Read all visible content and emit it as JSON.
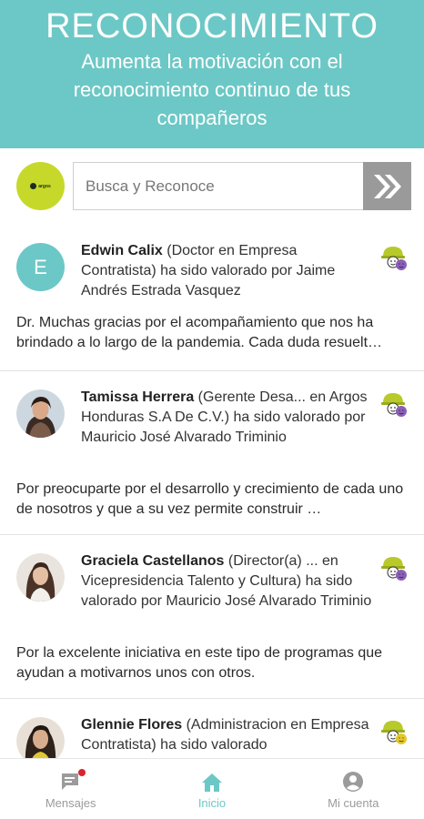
{
  "header": {
    "title": "RECONOCIMIENTO",
    "subtitle": "Aumenta la motivación con el reconocimiento continuo de tus compañeros"
  },
  "search": {
    "logo_text": "argos",
    "placeholder": "Busca y Reconoce"
  },
  "feed": [
    {
      "avatar_letter": "E",
      "name": "Edwin Calix",
      "detail": " (Doctor en Empresa Contratista) ha sido valorado por Jaime Andrés Estrada Vasquez",
      "message": "Dr. Muchas gracias por el acompañamiento  que  nos ha brindado a lo largo de la pandemia. Cada duda resuelt…"
    },
    {
      "name": "Tamissa Herrera",
      "detail": " (Gerente Desa... en Argos Honduras S.A De C.V.) ha sido valorado por Mauricio José Alvarado Triminio",
      "message": "Por preocuparte por el desarrollo y crecimiento de cada uno de nosotros y que a su vez permite construir …"
    },
    {
      "name": "Graciela Castellanos",
      "detail": " (Director(a) ... en Vicepresidencia Talento y Cultura) ha sido valorado por Mauricio José Alvarado Triminio",
      "message": "Por la excelente iniciativa en este tipo de programas que ayudan a motivarnos unos con otros."
    },
    {
      "name": "Glennie Flores",
      "detail": " (Administracion en Empresa Contratista) ha sido valorado"
    }
  ],
  "nav": {
    "messages": "Mensajes",
    "home": "Inicio",
    "account": "Mi cuenta"
  },
  "colors": {
    "accent": "#6cc8c6",
    "logo": "#c6d92a",
    "search_button": "#9a9a9a",
    "notification": "#d9232e"
  },
  "icons": [
    "double-chevron-right-icon",
    "helmet-smiley-icon",
    "chat-icon",
    "home-icon",
    "user-circle-icon"
  ]
}
